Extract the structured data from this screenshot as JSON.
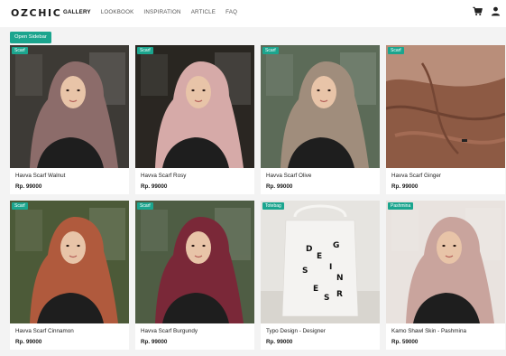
{
  "brand": {
    "logo": "OZCHIC"
  },
  "nav": {
    "links": [
      "GALLERY",
      "LOOKBOOK",
      "INSPIRATION",
      "ARTICLE",
      "FAQ"
    ],
    "active": "GALLERY",
    "icons": [
      "cart-icon",
      "user-icon"
    ]
  },
  "sidebar_button": "Open Sidebar",
  "accent_color": "#1ba58e",
  "products": [
    {
      "badge": "Scarf",
      "title": "Havva Scarf Walnut",
      "price": "Rp. 99000",
      "hijab_color": "#8c6c6a",
      "bg_color": "#3d3a36"
    },
    {
      "badge": "Scarf",
      "title": "Havva Scarf Rosy",
      "price": "Rp. 99000",
      "hijab_color": "#d6aaa8",
      "bg_color": "#2a2622"
    },
    {
      "badge": "Scarf",
      "title": "Havva Scarf Olive",
      "price": "Rp. 99000",
      "hijab_color": "#a08d7c",
      "bg_color": "#5c6b58"
    },
    {
      "badge": "Scarf",
      "title": "Havva Scarf Ginger",
      "price": "Rp. 99000",
      "hijab_color": "#8d5a44",
      "bg_color": "#b98e7a"
    },
    {
      "badge": "Scarf",
      "title": "Havva Scarf Cinnamon",
      "price": "Rp. 99000",
      "hijab_color": "#b05a3d",
      "bg_color": "#4c5a38"
    },
    {
      "badge": "Scarf",
      "title": "Havva Scarf Burgundy",
      "price": "Rp. 99000",
      "hijab_color": "#7a2838",
      "bg_color": "#4f5d44"
    },
    {
      "badge": "Totebag",
      "title": "Typo Design - Designer",
      "price": "Rp. 99000",
      "hijab_color": "#f4f3f1",
      "bg_color": "#e6e4e0"
    },
    {
      "badge": "Pashmina",
      "title": "Kamo Shawl Skin - Pashmina",
      "price": "Rp. 59000",
      "hijab_color": "#c9a49d",
      "bg_color": "#e9e3df"
    }
  ]
}
